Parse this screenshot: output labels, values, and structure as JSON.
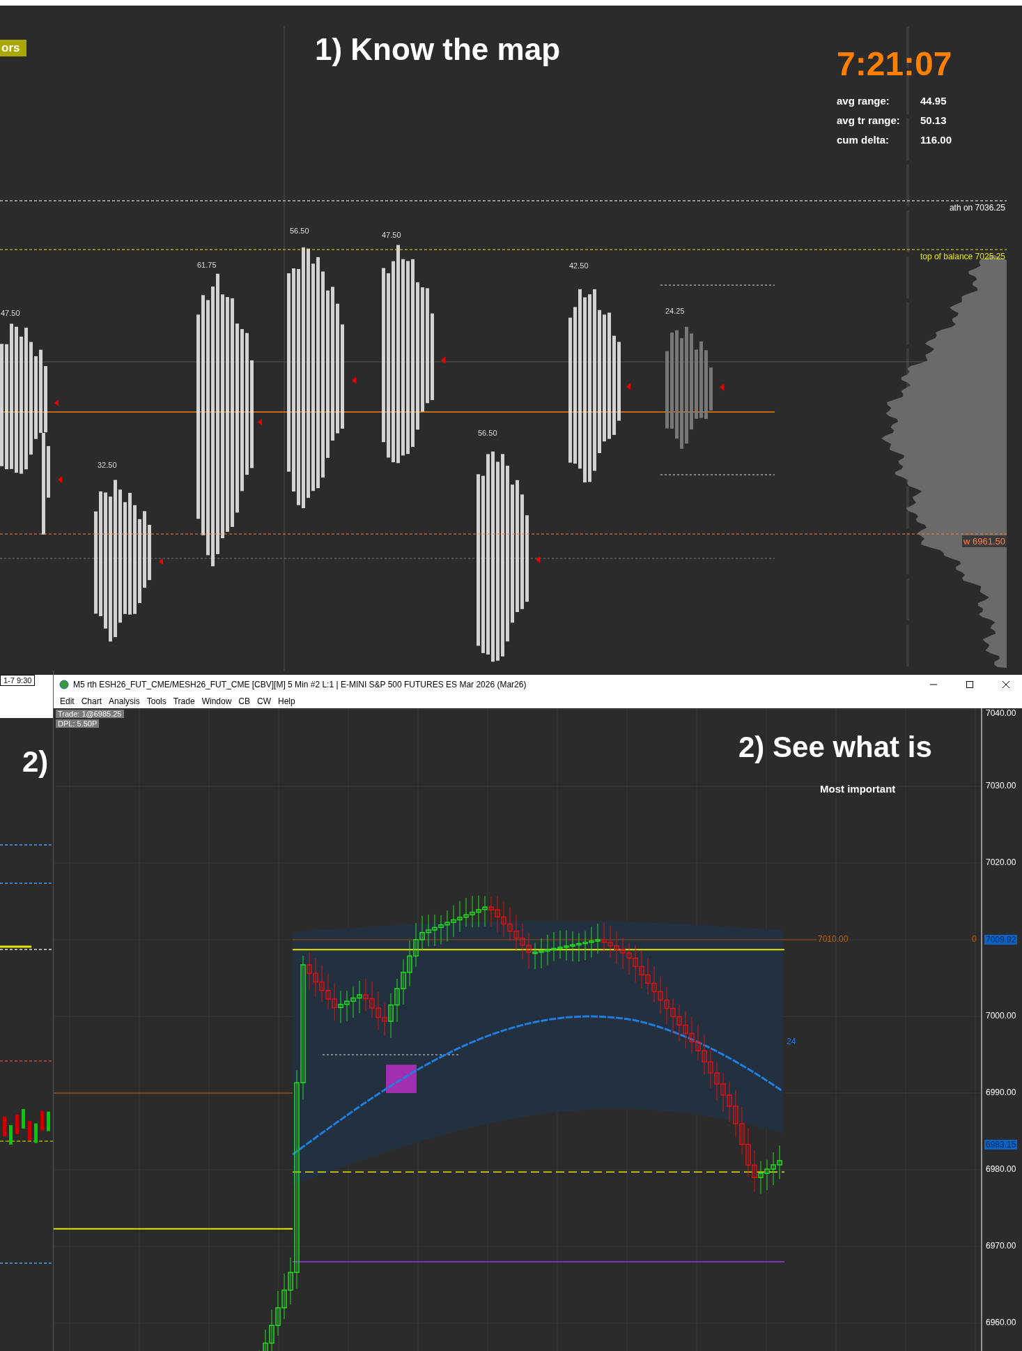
{
  "profile_chart": {
    "badge": "ors",
    "title": "1)  Know the map",
    "clock": "7:21:07",
    "stats": [
      {
        "label": "avg range:",
        "value": "44.95"
      },
      {
        "label": "avg tr range:",
        "value": "50.13"
      },
      {
        "label": "cum delta:",
        "value": "116.00"
      }
    ],
    "levels": [
      {
        "kind": "ath",
        "label": "ath on  7036.25"
      },
      {
        "kind": "balance",
        "label": "top of balance  7025.25"
      },
      {
        "kind": "weekly",
        "label": "w 6961.50"
      }
    ],
    "range_labels": [
      "47.50",
      "61.75",
      "56.50",
      "47.50",
      "42.50",
      "24.25",
      "56.50",
      "32.50"
    ]
  },
  "side_window": {
    "timestamp": "1-7 9:30",
    "title": "2)"
  },
  "chart_window": {
    "title": "M5 rth ESH26_FUT_CME/MESH26_FUT_CME [CBV][M]  5 Min  #2 L:1 | E-MINI S&P 500 FUTURES ES Mar 2026 (Mar26)",
    "menu": [
      "Edit",
      "Chart",
      "Analysis",
      "Tools",
      "Trade",
      "Window",
      "CB",
      "CW",
      "Help"
    ],
    "info": [
      "Trade: 1@6985.25",
      "DPL: 5.50P"
    ],
    "heading": "2)  See what is",
    "subheading": "Most important",
    "price_axis": [
      "7040.00",
      "7030.00",
      "7020.00",
      "7000.00",
      "6990.00",
      "6980.00",
      "6970.00",
      "6960.00"
    ],
    "markers": [
      {
        "kind": "level",
        "text": "7010.00"
      },
      {
        "kind": "count",
        "text": "0"
      },
      {
        "kind": "vwap",
        "text": "24"
      }
    ],
    "price_tags": [
      "7009.92",
      "6983.15"
    ]
  }
}
